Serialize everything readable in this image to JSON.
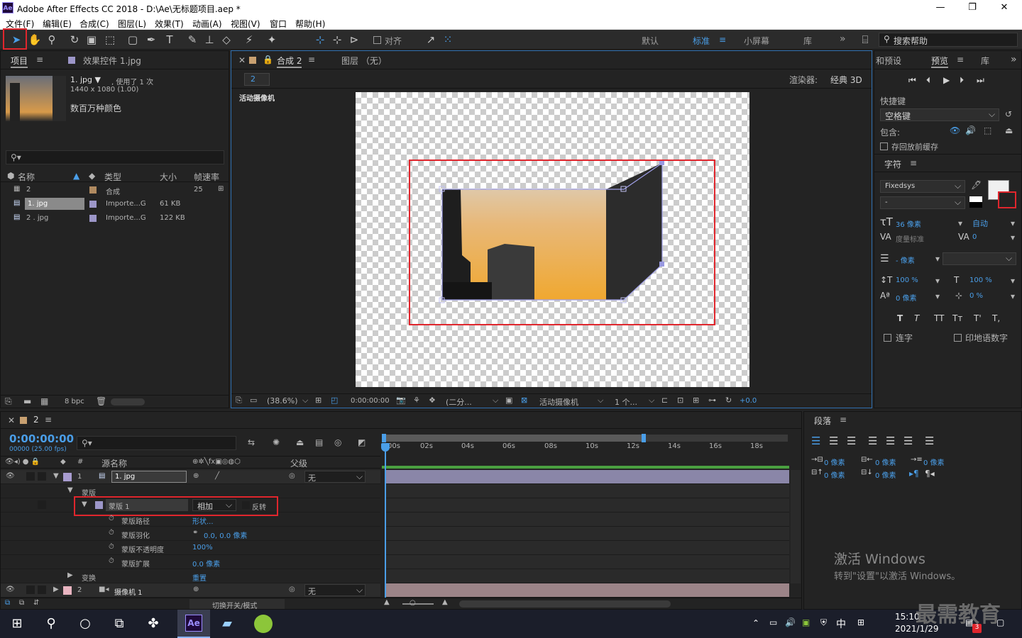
{
  "window": {
    "title": "Adobe After Effects CC 2018 - D:\\Ae\\无标题项目.aep *",
    "logo": "Ae",
    "minimize": "—",
    "maximize": "❐",
    "close": "✕"
  },
  "menu": [
    "文件(F)",
    "编辑(E)",
    "合成(C)",
    "图层(L)",
    "效果(T)",
    "动画(A)",
    "视图(V)",
    "窗口",
    "帮助(H)"
  ],
  "toolbar": {
    "snap_label": "对齐",
    "workspaces": [
      "默认",
      "标准",
      "小屏幕",
      "库"
    ],
    "active_workspace": "标准",
    "overflow": "»",
    "search_placeholder": "搜索帮助"
  },
  "project_panel": {
    "tab_project": "项目",
    "tab_effects": "效果控件 1.jpg",
    "preview_name": "1. jpg ▼",
    "preview_used": ", 使用了 1 次",
    "preview_dims": "1440 x 1080 (1.00)",
    "preview_colors": "数百万种颜色",
    "columns": [
      "名称",
      "类型",
      "大小",
      "帧速率"
    ],
    "items": [
      {
        "name": "2",
        "type": "合成",
        "size": "",
        "fps": "25",
        "color": "#b08a60"
      },
      {
        "name": "1. jpg",
        "type": "Importe...G",
        "size": "61 KB",
        "fps": "",
        "color": "#9c96c8"
      },
      {
        "name": "2 . jpg",
        "type": "Importe...G",
        "size": "122 KB",
        "fps": "",
        "color": "#9c96c8"
      }
    ],
    "bpc": "8 bpc"
  },
  "comp_panel": {
    "tab_comp": "合成 2",
    "tab_layer": "图层 （无）",
    "breadcrumb": "2",
    "renderer_label": "渲染器:",
    "renderer_value": "经典 3D",
    "camera_label": "活动摄像机",
    "zoom": "(38.6%)",
    "timecode": "0:00:00:00",
    "resolution": "(二分...",
    "view": "活动摄像机",
    "views_count": "1 个...",
    "exposure": "+0.0"
  },
  "right_panel": {
    "tab_effects_presets": "和预设",
    "tab_preview": "预览",
    "tab_library": "库",
    "shortcut_label": "快捷键",
    "shortcut_value": "空格键",
    "include_label": "包含:",
    "cache_label": "存回放前缓存",
    "char_title": "字符",
    "font": "Fixedsys",
    "font_style": "-",
    "font_size": "36 像素",
    "leading": "自动",
    "kerning": "度量标准",
    "tracking": "0",
    "stroke_width": "- 像素",
    "vscale": "100 %",
    "hscale": "100 %",
    "baseline": "0 像素",
    "tsume": "0 %",
    "style_buttons": [
      "T",
      "T",
      "TT",
      "Tт",
      "T'",
      "T,"
    ],
    "ligature_label": "连字",
    "hindi_label": "印地语数字",
    "para_title": "段落",
    "indent_values": [
      "0 像素",
      "0 像素",
      "0 像素",
      "0 像素",
      "0 像素"
    ]
  },
  "timeline": {
    "tab": "2",
    "timecode": "0:00:00:00",
    "timecode_sub": "00000 (25.00 fps)",
    "col_source": "源名称",
    "col_parent": "父级",
    "ruler": [
      "00s",
      "02s",
      "04s",
      "06s",
      "08s",
      "10s",
      "12s",
      "14s",
      "16s",
      "18s"
    ],
    "layer1": {
      "num": "1",
      "name": "1. jpg",
      "parent": "无",
      "color": "#a89cd0"
    },
    "masks_group": "蒙版",
    "mask1": {
      "name": "蒙版 1",
      "mode": "相加",
      "invert": "反转"
    },
    "mask_props": [
      {
        "label": "蒙版路径",
        "value": "形状..."
      },
      {
        "label": "蒙版羽化",
        "value": "0.0, 0.0 像素"
      },
      {
        "label": "蒙版不透明度",
        "value": "100%"
      },
      {
        "label": "蒙版扩展",
        "value": "0.0 像素"
      }
    ],
    "transform_label": "变换",
    "transform_value": "重置",
    "layer2": {
      "num": "2",
      "name": "摄像机 1",
      "parent": "无",
      "color": "#e8b4c0"
    },
    "toggle_label": "切换开关/模式"
  },
  "watermark": {
    "activate_title": "激活 Windows",
    "activate_sub": "转到\"设置\"以激活 Windows。",
    "brand": "最需教育"
  },
  "taskbar": {
    "time": "15:10",
    "date": "2021/1/29",
    "ime": "中",
    "notify_count": "3"
  },
  "colors": {
    "accent_blue": "#4a9ee8",
    "highlight_red": "#e0262d",
    "timeline_green": "#4aa040"
  }
}
